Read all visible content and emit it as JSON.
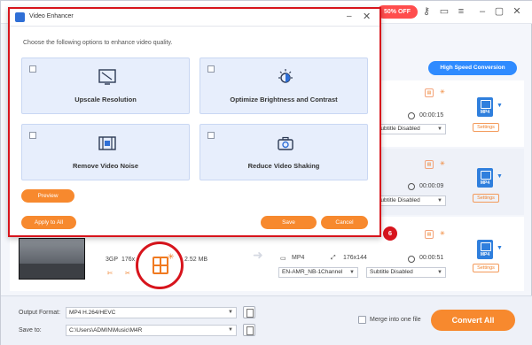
{
  "topbar": {
    "promo": "50% OFF"
  },
  "list": {
    "high_speed": "High Speed Conversion",
    "rows": [
      {
        "duration": "00:00:15",
        "subtitle": "Subtitle Disabled",
        "format": "MP4",
        "settings": "Settings"
      },
      {
        "duration": "00:00:09",
        "subtitle": "Subtitle Disabled",
        "format": "MP4",
        "settings": "Settings"
      },
      {
        "src_format": "3GP",
        "src_res": "176x",
        "src_size": "2.52 MB",
        "out_format": "MP4",
        "out_res": "176x144",
        "duration": "00:00:51",
        "audio": "EN-AMR_NB-1Channel",
        "subtitle": "Subtitle Disabled",
        "format": "MP4",
        "settings": "Settings"
      }
    ]
  },
  "callout": {
    "number": "6"
  },
  "bottom": {
    "output_format_label": "Output Format:",
    "output_format_value": "MP4 H.264/HEVC",
    "save_to_label": "Save to:",
    "save_to_value": "C:\\Users\\ADMIN\\Music\\M4R",
    "merge_label": "Merge into one file",
    "convert_all": "Convert All"
  },
  "dialog": {
    "title": "Video Enhancer",
    "hint": "Choose the following options to enhance video quality.",
    "options": [
      {
        "label": "Upscale Resolution",
        "icon": "upscale-icon"
      },
      {
        "label": "Optimize Brightness and Contrast",
        "icon": "brightness-icon"
      },
      {
        "label": "Remove Video Noise",
        "icon": "film-icon"
      },
      {
        "label": "Reduce Video Shaking",
        "icon": "camera-icon"
      }
    ],
    "preview": "Preview",
    "apply_all": "Apply to All",
    "save": "Save",
    "cancel": "Cancel"
  },
  "colors": {
    "accent": "#f7892e",
    "highlight": "#d7141c",
    "blue": "#2f8bff"
  }
}
